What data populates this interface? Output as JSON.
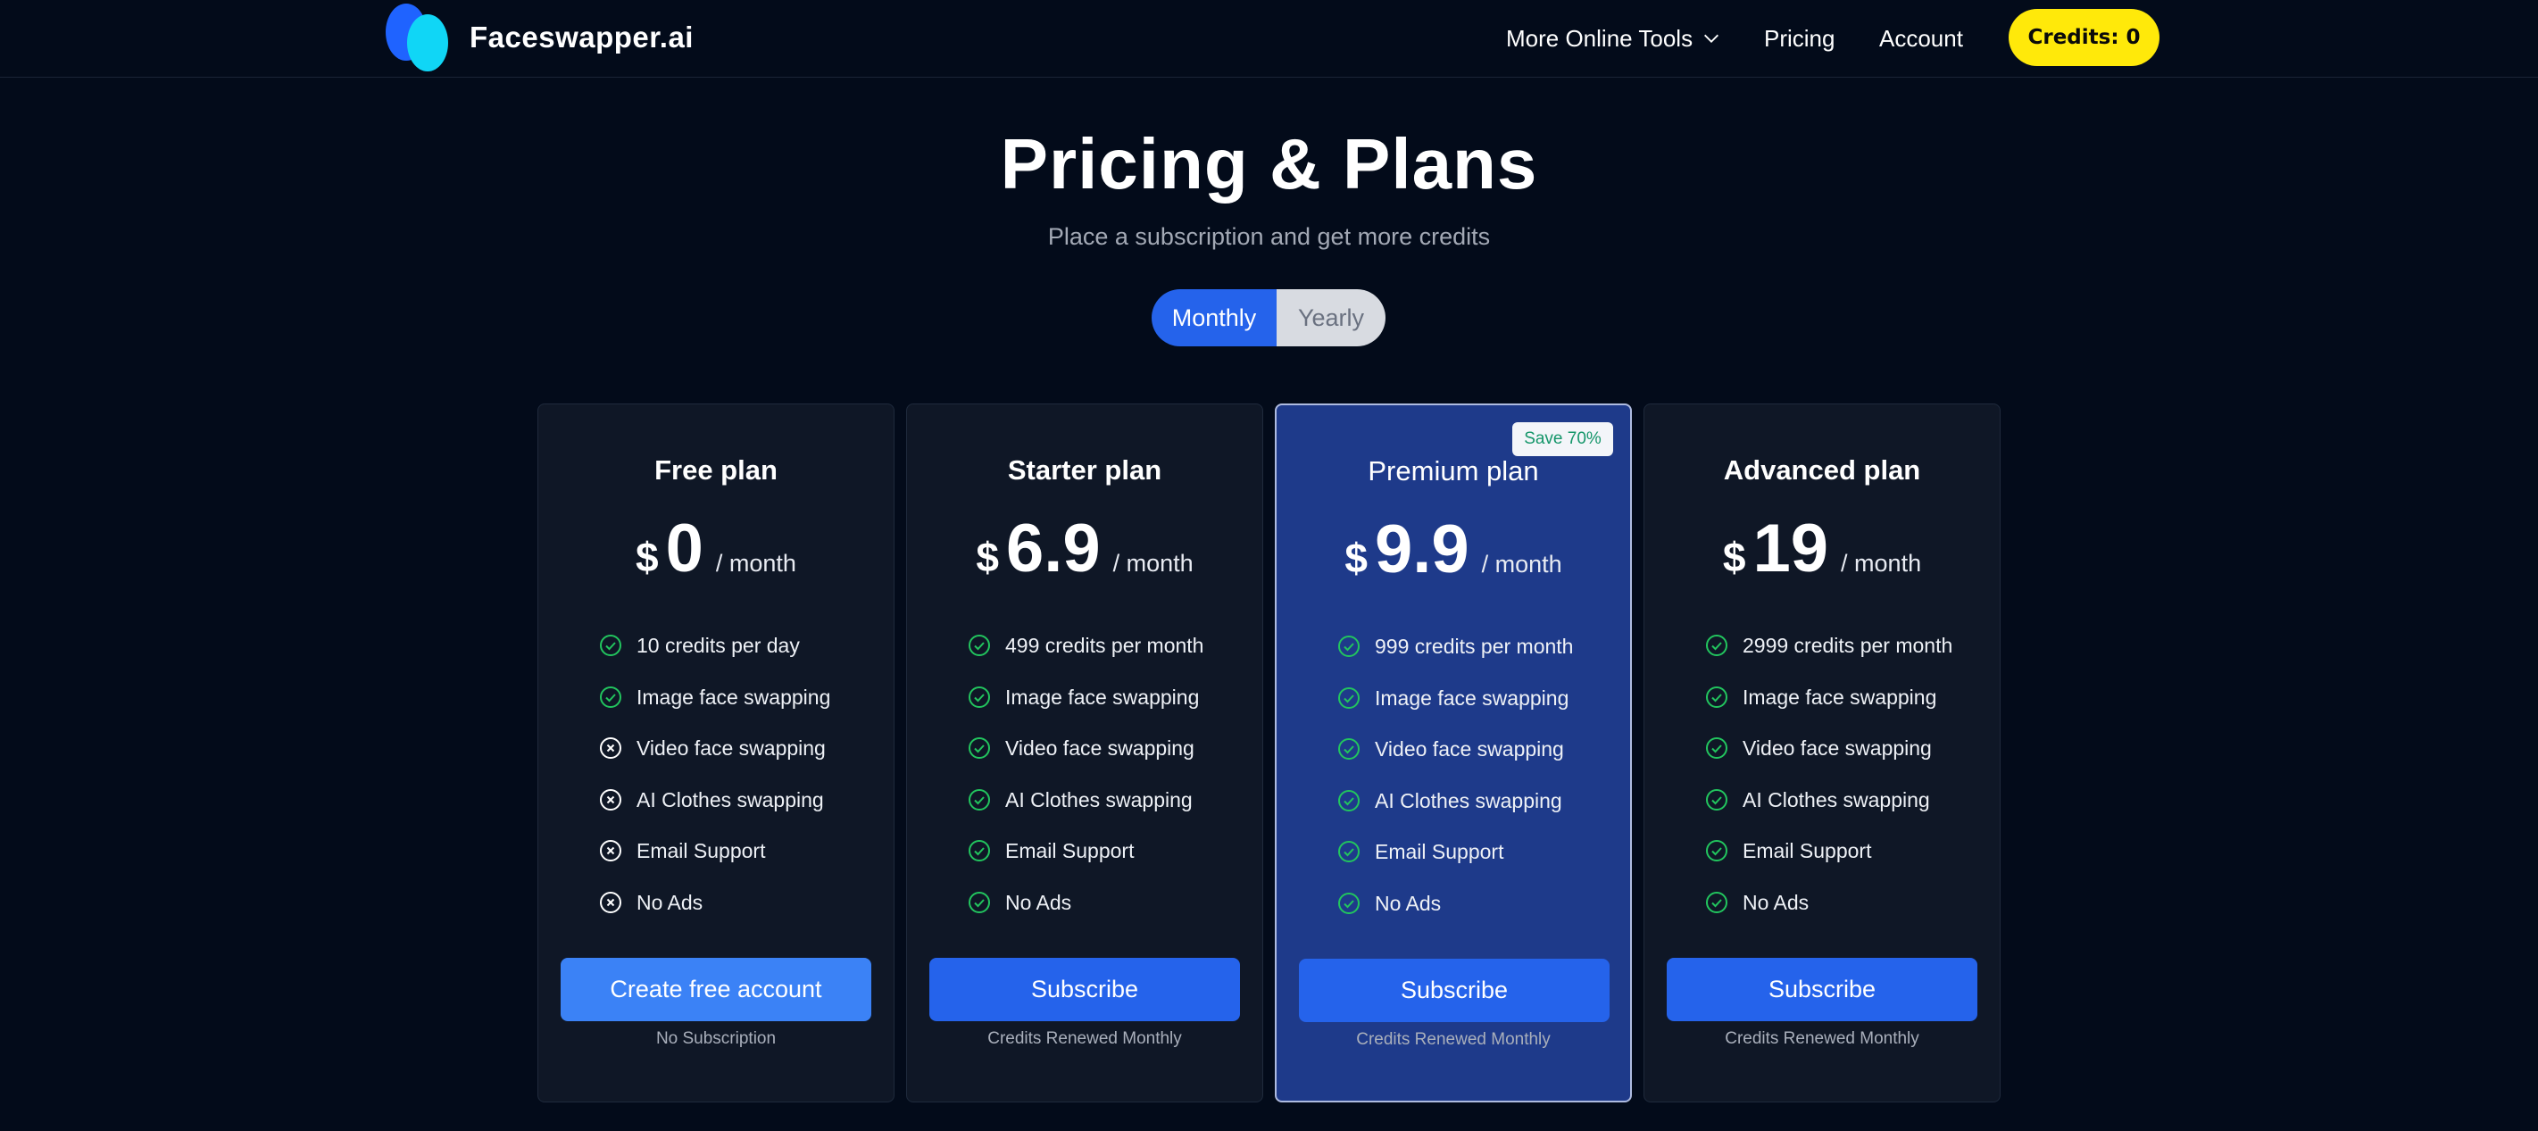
{
  "brand": {
    "name": "Faceswapper.ai",
    "colors": {
      "primary": "#1f63ff",
      "secondary": "#10d6f6"
    }
  },
  "nav": {
    "tools_label": "More Online Tools",
    "tools_icon": "chevron-down-icon",
    "pricing_label": "Pricing",
    "account_label": "Account",
    "credits_label": "Credits: 0",
    "credits_color": "#ffe90a"
  },
  "hero": {
    "title": "Pricing & Plans",
    "subtitle": "Place a subscription and get more credits"
  },
  "billing_toggle": {
    "monthly_label": "Monthly",
    "yearly_label": "Yearly",
    "selected": "Monthly"
  },
  "plans": [
    {
      "name": "Free plan",
      "currency": "$",
      "amount": "0",
      "period": "/ month",
      "features": [
        {
          "text": "10 credits per day",
          "included": true
        },
        {
          "text": "Image face swapping",
          "included": true
        },
        {
          "text": "Video face swapping",
          "included": false
        },
        {
          "text": "AI Clothes swapping",
          "included": false
        },
        {
          "text": "Email Support",
          "included": false
        },
        {
          "text": "No Ads",
          "included": false
        }
      ],
      "button_label": "Create free account",
      "note": "No Subscription"
    },
    {
      "name": "Starter plan",
      "currency": "$",
      "amount": "6.9",
      "period": "/ month",
      "features": [
        {
          "text": "499 credits per month",
          "included": true
        },
        {
          "text": "Image face swapping",
          "included": true
        },
        {
          "text": "Video face swapping",
          "included": true
        },
        {
          "text": "AI Clothes swapping",
          "included": true
        },
        {
          "text": "Email Support",
          "included": true
        },
        {
          "text": "No Ads",
          "included": true
        }
      ],
      "button_label": "Subscribe",
      "note": "Credits Renewed Monthly"
    },
    {
      "name": "Premium plan",
      "currency": "$",
      "amount": "9.9",
      "period": "/ month",
      "badge": "Save 70%",
      "features": [
        {
          "text": "999 credits per month",
          "included": true
        },
        {
          "text": "Image face swapping",
          "included": true
        },
        {
          "text": "Video face swapping",
          "included": true
        },
        {
          "text": "AI Clothes swapping",
          "included": true
        },
        {
          "text": "Email Support",
          "included": true
        },
        {
          "text": "No Ads",
          "included": true
        }
      ],
      "button_label": "Subscribe",
      "note": "Credits Renewed Monthly"
    },
    {
      "name": "Advanced plan",
      "currency": "$",
      "amount": "19",
      "period": "/ month",
      "features": [
        {
          "text": "2999 credits per month",
          "included": true
        },
        {
          "text": "Image face swapping",
          "included": true
        },
        {
          "text": "Video face swapping",
          "included": true
        },
        {
          "text": "AI Clothes swapping",
          "included": true
        },
        {
          "text": "Email Support",
          "included": true
        },
        {
          "text": "No Ads",
          "included": true
        }
      ],
      "button_label": "Subscribe",
      "note": "Credits Renewed Monthly"
    }
  ],
  "status_colors": {
    "included": "#22c55e",
    "excluded": "#ffffff"
  }
}
